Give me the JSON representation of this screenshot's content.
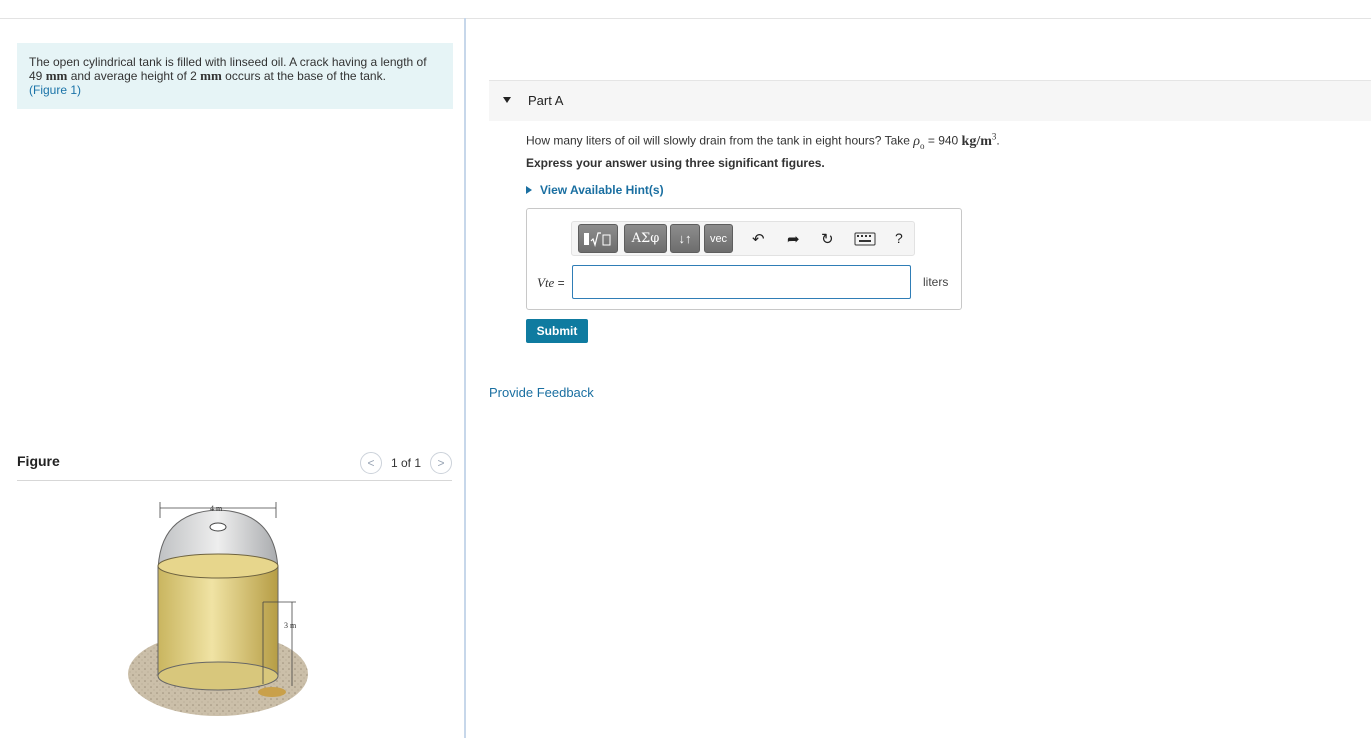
{
  "problem": {
    "text_1": "The open cylindrical tank is filled with linseed oil. A crack having a length of",
    "text_2_a": "49 ",
    "text_2_unit1": "mm",
    "text_2_b": " and average height of 2 ",
    "text_2_unit2": "mm",
    "text_2_c": " occurs at the base of the tank.",
    "figure_link": "(Figure 1)"
  },
  "figure": {
    "title": "Figure",
    "counter": "1 of 1",
    "prev_icon": "chevron-left-icon",
    "next_icon": "chevron-right-icon",
    "dim_width": "4 m",
    "dim_height": "3 m"
  },
  "part": {
    "title": "Part A",
    "question_prefix": "How many liters of oil will slowly drain from the tank in eight hours? Take ",
    "rho_symbol": "ρ",
    "rho_sub": "o",
    "rho_eq": " = 940 ",
    "rho_units": "kg/m",
    "rho_exp": "3",
    "question_suffix": ".",
    "instruction": "Express your answer using three significant figures.",
    "hint_link": "View Available Hint(s)"
  },
  "toolbar": {
    "greek": "ΑΣφ",
    "arrows": "↓↑",
    "vec": "vec",
    "help": "?"
  },
  "answer": {
    "variable": "Vte",
    "equals": " =",
    "value": "",
    "units": "liters"
  },
  "actions": {
    "submit": "Submit",
    "feedback": "Provide Feedback"
  },
  "colors": {
    "accent": "#0f7ba0",
    "link": "#1a6fa1",
    "problem_bg": "#e6f4f6"
  }
}
